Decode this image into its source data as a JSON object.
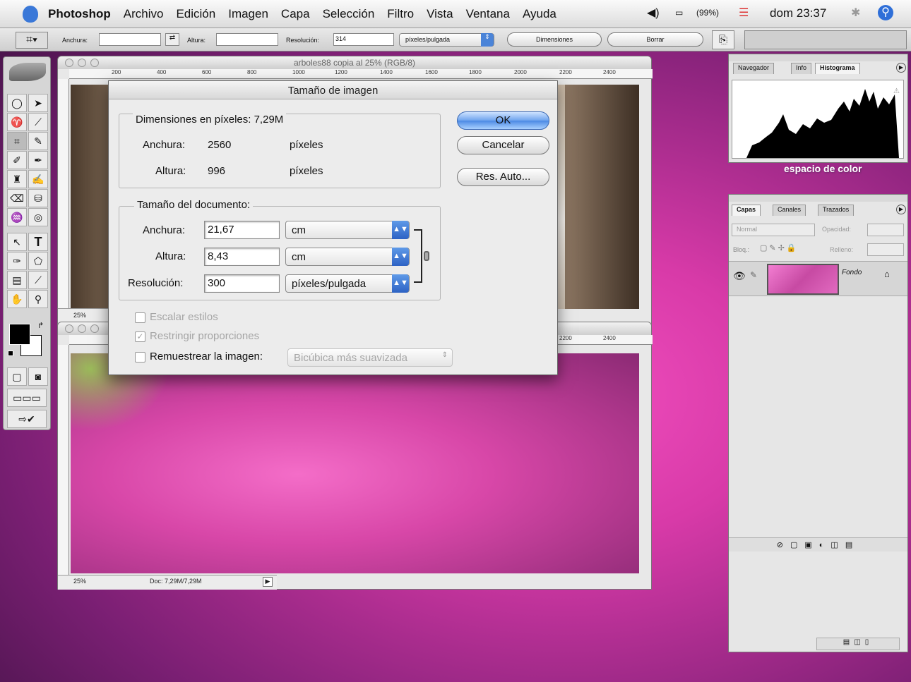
{
  "menubar": {
    "app": "Photoshop",
    "items": [
      "Archivo",
      "Edición",
      "Imagen",
      "Capa",
      "Selección",
      "Filtro",
      "Vista",
      "Ventana",
      "Ayuda"
    ],
    "battery": "(99%)",
    "clock": "dom 23:37"
  },
  "options": {
    "width_label": "Anchura:",
    "height_label": "Altura:",
    "resolution_label": "Resolución:",
    "resolution_value": "314",
    "resolution_unit": "píxeles/pulgada",
    "dimensions_button": "Dimensiones",
    "clear_button": "Borrar"
  },
  "doc1": {
    "title": "arboles88 copia al 25% (RGB/8)",
    "ruler": [
      "200",
      "400",
      "600",
      "800",
      "1000",
      "1200",
      "1400",
      "1600",
      "1800",
      "2000",
      "2200",
      "2400"
    ],
    "zoom": "25%"
  },
  "doc2": {
    "ruler": [
      "2200",
      "2400"
    ],
    "zoom": "25%",
    "doc_info": "Doc: 7,29M/7,29M"
  },
  "dialog": {
    "title": "Tamaño de imagen",
    "pixel_dims": "Dimensiones en píxeles: 7,29M",
    "px_width_label": "Anchura:",
    "px_width": "2560",
    "px_width_unit": "píxeles",
    "px_height_label": "Altura:",
    "px_height": "996",
    "px_height_unit": "píxeles",
    "doc_size": "Tamaño del documento:",
    "doc_width_label": "Anchura:",
    "doc_width": "21,67",
    "doc_width_unit": "cm",
    "doc_height_label": "Altura:",
    "doc_height": "8,43",
    "doc_height_unit": "cm",
    "resolution_label": "Resolución:",
    "resolution": "300",
    "resolution_unit": "píxeles/pulgada",
    "scale_styles": "Escalar estilos",
    "constrain": "Restringir proporciones",
    "resample": "Remuestrear la imagen:",
    "resample_method": "Bicúbica más suavizada",
    "ok": "OK",
    "cancel": "Cancelar",
    "auto": "Res. Auto..."
  },
  "navigator": {
    "tabs": [
      "Navegador",
      "Info",
      "Histograma"
    ],
    "caption": "espacio de color"
  },
  "layers": {
    "tabs": [
      "Capas",
      "Canales",
      "Trazados"
    ],
    "blend_mode": "Normal",
    "opacity_label": "Opacidad:",
    "lock_label": "Bloq.:",
    "fill_label": "Relleno:",
    "layer_name": "Fondo"
  }
}
